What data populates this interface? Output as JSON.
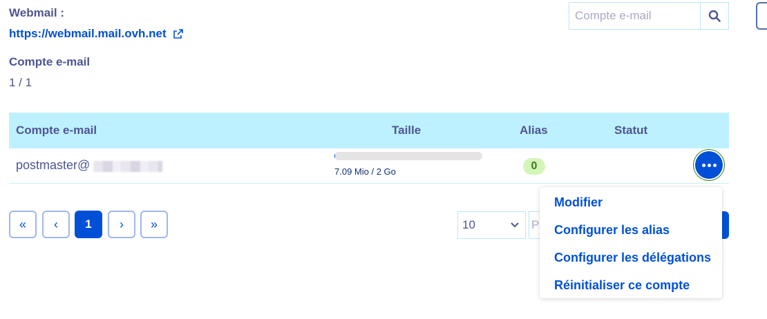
{
  "webmail": {
    "label": "Webmail :",
    "url": "https://webmail.mail.ovh.net"
  },
  "account_count": {
    "label": "Compte e-mail",
    "value": "1 / 1"
  },
  "search": {
    "placeholder": "Compte e-mail"
  },
  "table": {
    "headers": [
      "Compte e-mail",
      "Taille",
      "Alias",
      "Statut"
    ],
    "rows": [
      {
        "email": "postmaster@",
        "usage_text": "7.09 Mio / 2 Go",
        "usage_fraction": 0.0035,
        "alias": "0"
      }
    ]
  },
  "pagination": {
    "first": "«",
    "prev": "‹",
    "current": "1",
    "next": "›",
    "last": "»",
    "page_size": "10",
    "page_input_placeholder": "P"
  },
  "menu": {
    "items": [
      "Modifier",
      "Configurer les alias",
      "Configurer les délégations",
      "Réinitialiser ce compte"
    ]
  },
  "colors": {
    "accent": "#0050d7",
    "header_bg": "#bef1ff",
    "text": "#4d5592",
    "badge_bg": "#d4f5b8"
  },
  "icons": {
    "external": "external-link-icon",
    "search": "search-icon",
    "actions": "ellipsis-icon",
    "dropdown": "chevron-down-icon"
  }
}
